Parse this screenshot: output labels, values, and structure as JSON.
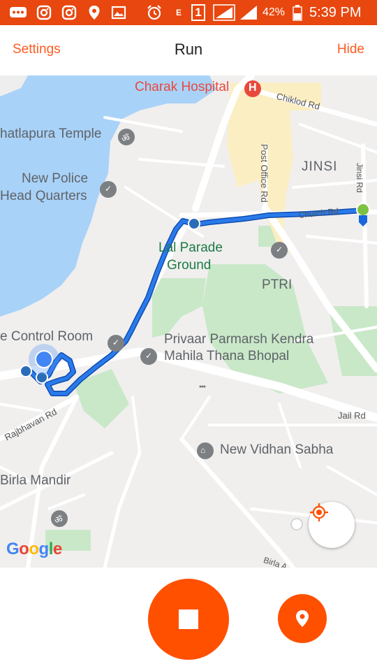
{
  "status_bar": {
    "battery": "42%",
    "time": "5:39 PM",
    "signal_label": "1",
    "network_label": "E"
  },
  "header": {
    "settings_label": "Settings",
    "title": "Run",
    "hide_label": "Hide"
  },
  "map": {
    "labels": {
      "charak_hospital": "Charak Hospital",
      "chiklod_rd": "Chiklod Rd",
      "hatlapura_temple": "hatlapura Temple",
      "jinsi": "JINSI",
      "jinsi_rd": "Jinsi Rd",
      "post_office_rd": "Post Office Rd",
      "new_police_1": "New Police",
      "new_police_2": "Head Quarters",
      "church_rd": "Church Rd",
      "lal_parade_1": "Lal Parade",
      "lal_parade_2": "Ground",
      "ptri": "PTRI",
      "control_room": "e Control Room",
      "privaar_1": "Privaar Parmarsh Kendra",
      "privaar_2": "Mahila Thana Bhopal",
      "rajbhavan_rd": "Rajbhavan Rd",
      "jail_rd": "Jail Rd",
      "new_vidhan_sabha": "New Vidhan Sabha",
      "birla_mandir": "Birla Mandir",
      "birla_rd": "Birla A",
      "google": "Google"
    }
  },
  "colors": {
    "accent": "#ff5000",
    "status_bar": "#e8470f",
    "route": "#1a66dd",
    "start_marker": "#7cc243"
  }
}
